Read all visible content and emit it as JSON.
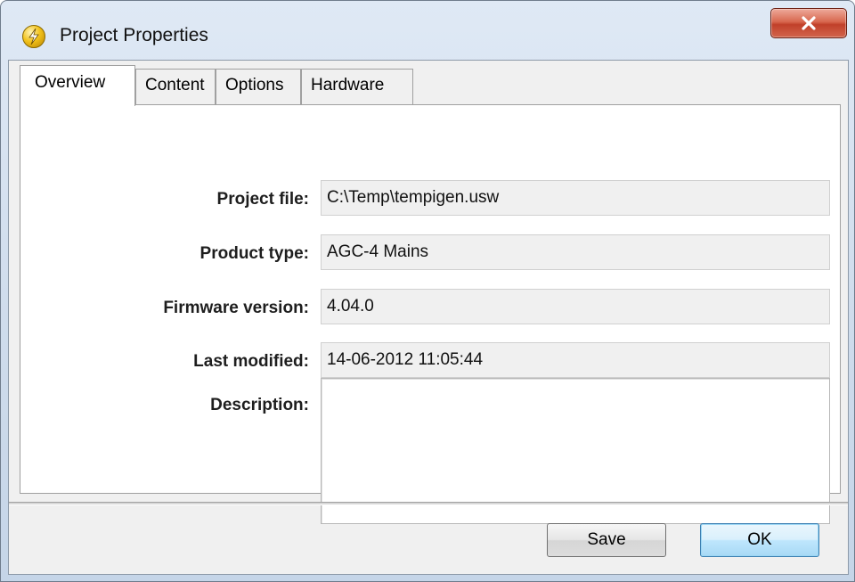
{
  "window": {
    "title": "Project Properties",
    "icon": "lightning-bolt-icon",
    "close_icon": "close-icon"
  },
  "tabs": [
    {
      "label": "Overview",
      "active": true
    },
    {
      "label": "Content",
      "active": false
    },
    {
      "label": "Options",
      "active": false
    },
    {
      "label": "Hardware",
      "active": false
    }
  ],
  "overview": {
    "fields": [
      {
        "label": "Project file:",
        "value": "C:\\Temp\\tempigen.usw"
      },
      {
        "label": "Product type:",
        "value": "AGC-4 Mains"
      },
      {
        "label": "Firmware version:",
        "value": "4.04.0"
      },
      {
        "label": "Last modified:",
        "value": "14-06-2012 11:05:44"
      }
    ],
    "description_label": "Description:",
    "description_value": ""
  },
  "buttons": {
    "save_label": "Save",
    "ok_label": "OK"
  },
  "colors": {
    "close_button": "#c1402a",
    "default_button_border": "#3c7fb1",
    "field_background": "#f0f0f0"
  }
}
